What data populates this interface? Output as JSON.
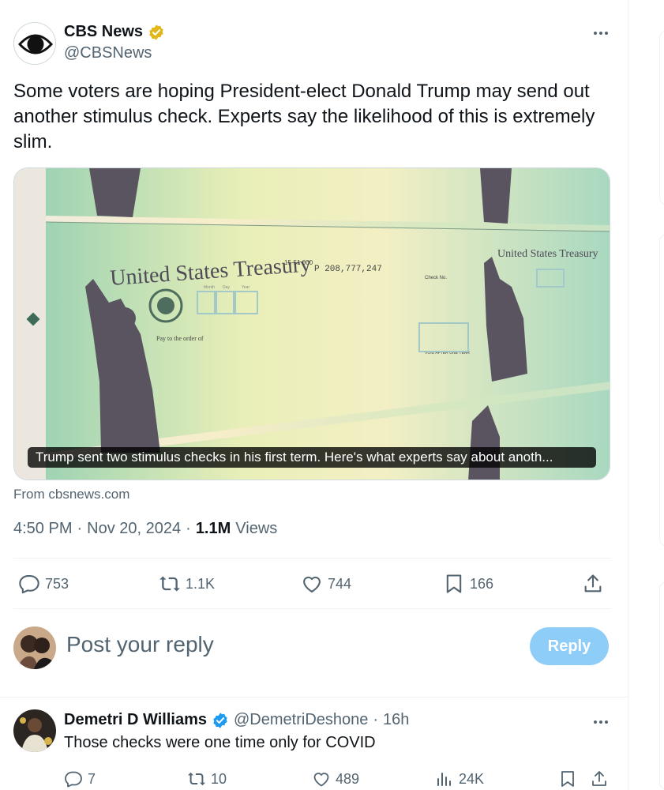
{
  "tweet": {
    "author_name": "CBS News",
    "author_handle": "@CBSNews",
    "text": "Some voters are hoping President-elect Donald Trump may send out another stimulus check. Experts say the likelihood of this is extremely slim.",
    "media": {
      "caption": "Trump sent two stimulus checks in his first term. Here's what experts say about anoth...",
      "check_title": "United States Treasury",
      "check_number": "P 208,777,247",
      "check_code": "15-51 000",
      "pay_to_label": "Pay to the order of",
      "void_label": "VOID AFTER ONE YEAR",
      "date_labels": [
        "Month",
        "Day",
        "Year"
      ],
      "check_no_label": "Check No."
    },
    "source": "From cbsnews.com",
    "time": "4:50 PM",
    "date": "Nov 20, 2024",
    "views_count": "1.1M",
    "views_label": "Views",
    "replies": "753",
    "reposts": "1.1K",
    "likes": "744",
    "bookmarks": "166"
  },
  "composer": {
    "placeholder": "Post your reply",
    "reply_button": "Reply"
  },
  "reply": {
    "author_name": "Demetri D Williams",
    "author_handle": "@DemetriDeshone",
    "time_ago": "16h",
    "text": "Those checks were one time only for COVID",
    "replies": "7",
    "reposts": "10",
    "likes": "489",
    "views": "24K"
  },
  "colors": {
    "text_primary": "#0f1419",
    "text_secondary": "#536471",
    "brand_blue": "#1d9bf0",
    "reply_button_disabled": "#8ecdf8",
    "gold_badge": "#e2b719"
  },
  "icons": [
    "cbs-eye-logo",
    "gold-verified-badge",
    "blue-verified-badge",
    "more-icon",
    "reply-icon",
    "repost-icon",
    "like-icon",
    "bookmark-icon",
    "share-icon",
    "views-icon"
  ]
}
